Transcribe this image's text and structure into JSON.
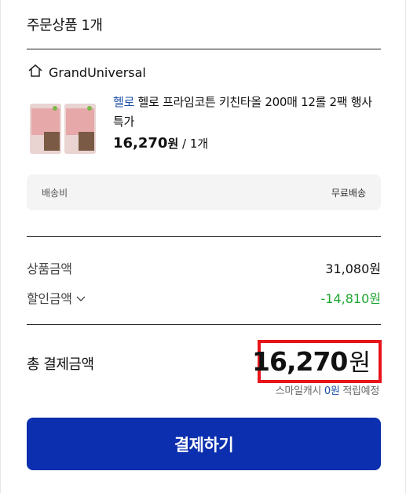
{
  "order": {
    "title": "주문상품 1개",
    "seller": "GrandUniversal",
    "product": {
      "brand": "헬로",
      "name": " 헬로 프라임코튼 키친타올 200매 12롤 2팩 행사 특가",
      "price_num": "16,270",
      "price_unit": "원",
      "qty": " / 1개"
    },
    "shipping": {
      "label": "배송비",
      "value": "무료배송"
    }
  },
  "summary": {
    "product_amount_label": "상품금액",
    "product_amount": "31,080원",
    "discount_label": "할인금액",
    "discount_amount": "-14,810원",
    "total_label": "총 결제금액",
    "total_num": "16,270",
    "total_unit": "원",
    "smile_prefix": "스마일캐시 ",
    "smile_amount": "0원",
    "smile_suffix": " 적립예정"
  },
  "pay_button": "결제하기",
  "colors": {
    "accent": "#0b2fae",
    "discount": "#1fa531",
    "highlight": "#e8141c",
    "brand": "#1d4fa8"
  },
  "icons": [
    "home-icon",
    "chevron-down-icon"
  ]
}
